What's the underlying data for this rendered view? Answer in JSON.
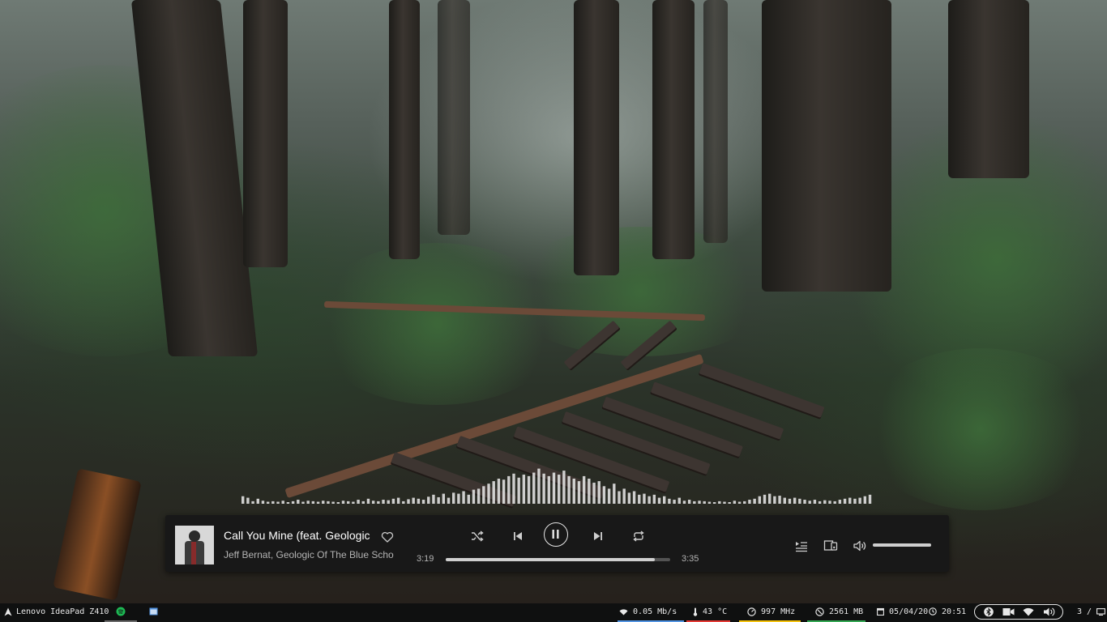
{
  "player": {
    "title": "Call You Mine (feat. Geologic",
    "artist": "Jeff Bernat, Geologic Of The Blue Scho",
    "elapsed": "3:19",
    "duration": "3:35",
    "progress_fraction": 0.93,
    "volume_fraction": 1.0,
    "liked": false,
    "playing": true,
    "icons": {
      "like": "heart-icon",
      "shuffle": "shuffle-icon",
      "previous": "skip-previous-icon",
      "play_pause": "pause-icon",
      "next": "skip-next-icon",
      "repeat": "repeat-icon",
      "queue": "queue-icon",
      "devices": "connect-device-icon",
      "volume": "volume-icon"
    }
  },
  "visualizer": {
    "levels": [
      0.15,
      0.12,
      0.05,
      0.1,
      0.06,
      0.04,
      0.05,
      0.04,
      0.06,
      0.03,
      0.05,
      0.08,
      0.04,
      0.06,
      0.05,
      0.04,
      0.06,
      0.05,
      0.04,
      0.03,
      0.06,
      0.05,
      0.04,
      0.08,
      0.05,
      0.1,
      0.06,
      0.05,
      0.08,
      0.07,
      0.1,
      0.12,
      0.05,
      0.09,
      0.12,
      0.1,
      0.08,
      0.14,
      0.18,
      0.13,
      0.2,
      0.12,
      0.22,
      0.2,
      0.25,
      0.18,
      0.28,
      0.3,
      0.35,
      0.4,
      0.45,
      0.5,
      0.48,
      0.55,
      0.6,
      0.52,
      0.58,
      0.55,
      0.62,
      0.7,
      0.6,
      0.55,
      0.62,
      0.58,
      0.66,
      0.55,
      0.5,
      0.45,
      0.55,
      0.5,
      0.42,
      0.45,
      0.35,
      0.3,
      0.4,
      0.25,
      0.3,
      0.22,
      0.25,
      0.18,
      0.2,
      0.15,
      0.18,
      0.12,
      0.15,
      0.1,
      0.08,
      0.12,
      0.06,
      0.08,
      0.05,
      0.06,
      0.05,
      0.04,
      0.03,
      0.05,
      0.04,
      0.03,
      0.06,
      0.04,
      0.05,
      0.08,
      0.1,
      0.15,
      0.18,
      0.2,
      0.15,
      0.16,
      0.12,
      0.1,
      0.12,
      0.1,
      0.08,
      0.06,
      0.08,
      0.05,
      0.07,
      0.06,
      0.05,
      0.08,
      0.1,
      0.12,
      0.1,
      0.12,
      0.15,
      0.18
    ]
  },
  "statusbar": {
    "launcher_icon": "arch-linux-icon",
    "hostname": "Lenovo IdeaPad Z410",
    "apps": [
      {
        "icon": "spotify-icon"
      },
      {
        "icon": "window-icon"
      }
    ],
    "network": {
      "icon": "wifi-icon",
      "text": "0.05 Mb/s",
      "color": "#5294e2"
    },
    "temperature": {
      "icon": "thermometer-icon",
      "text": "43 °C",
      "color": "#e53935"
    },
    "cpu": {
      "icon": "cpu-gauge-icon",
      "text": "997 MHz",
      "color": "#f4c20d"
    },
    "memory": {
      "icon": "memory-icon",
      "text": "2561 MB",
      "color": "#34a853"
    },
    "date": {
      "icon": "calendar-icon",
      "text": "05/04/20"
    },
    "time": {
      "icon": "clock-icon",
      "text": "20:51"
    },
    "tray": [
      "bluetooth-icon",
      "camera-icon",
      "wifi-icon",
      "volume-icon"
    ],
    "workspace": "3 / ",
    "workspace_icon": "monitor-icon"
  },
  "colors": {
    "player_bg": "#181818",
    "statusbar_bg": "#0f1010",
    "progress_fill": "#cfcfcf"
  }
}
